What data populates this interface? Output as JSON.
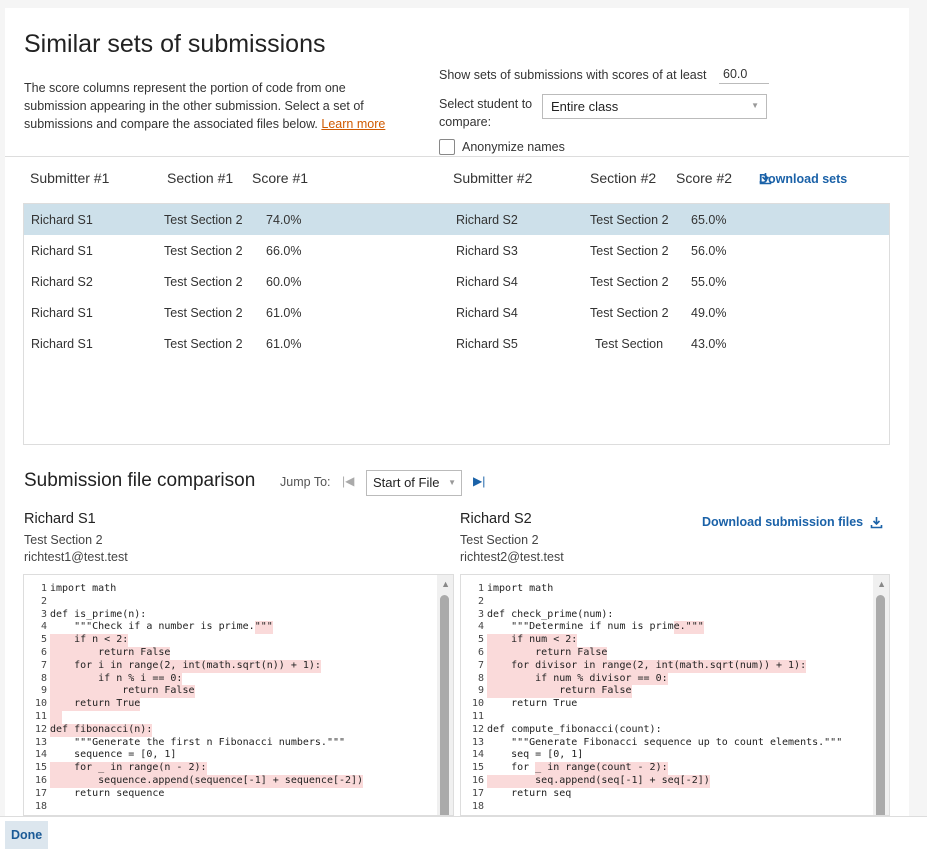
{
  "page": {
    "title": "Similar sets of submissions",
    "intro_text": "The score columns represent the portion of code from one submission appearing in the other submission. Select a set of submissions and compare the associated files below.",
    "learn_more": "Learn more"
  },
  "controls": {
    "threshold_label": "Show sets of submissions with scores of at least",
    "threshold_value": "60.0",
    "student_label": "Select student to compare:",
    "student_selected": "Entire class",
    "anonymize_label": "Anonymize names"
  },
  "table": {
    "headers": {
      "submitter1": "Submitter #1",
      "section1": "Section #1",
      "score1": "Score #1",
      "submitter2": "Submitter #2",
      "section2": "Section #2",
      "score2": "Score #2"
    },
    "download_sets": "Download sets",
    "rows": [
      {
        "sub1": "Richard S1",
        "sec1": "Test Section 2",
        "score1": "74.0%",
        "sub2": "Richard S2",
        "sec2": "Test Section 2",
        "score2": "65.0%"
      },
      {
        "sub1": "Richard S1",
        "sec1": "Test Section 2",
        "score1": "66.0%",
        "sub2": "Richard S3",
        "sec2": "Test Section 2",
        "score2": "56.0%"
      },
      {
        "sub1": "Richard S2",
        "sec1": "Test Section 2",
        "score1": "60.0%",
        "sub2": "Richard S4",
        "sec2": "Test Section 2",
        "score2": "55.0%"
      },
      {
        "sub1": "Richard S1",
        "sec1": "Test Section 2",
        "score1": "61.0%",
        "sub2": "Richard S4",
        "sec2": "Test Section 2",
        "score2": "49.0%"
      },
      {
        "sub1": "Richard S1",
        "sec1": "Test Section 2",
        "score1": "61.0%",
        "sub2": "Richard S5",
        "sec2": "Test Section",
        "score2": "43.0%"
      }
    ]
  },
  "comparison": {
    "title": "Submission file comparison",
    "jump_label": "Jump To:",
    "jump_selected": "Start of File",
    "download_files": "Download submission files",
    "left": {
      "name": "Richard S1",
      "section": "Test Section 2",
      "email": "richtest1@test.test"
    },
    "right": {
      "name": "Richard S2",
      "section": "Test Section 2",
      "email": "richtest2@test.test"
    }
  },
  "code_left": [
    {
      "n": "1",
      "segs": [
        [
          "import math",
          false
        ]
      ]
    },
    {
      "n": "2",
      "segs": [
        [
          "",
          false
        ]
      ]
    },
    {
      "n": "3",
      "segs": [
        [
          "def is_prime(n):",
          false
        ]
      ]
    },
    {
      "n": "4",
      "segs": [
        [
          "    \"\"\"Check if a number is prime.",
          false
        ],
        [
          "\"\"\"",
          true
        ]
      ]
    },
    {
      "n": "5",
      "segs": [
        [
          "    if n < 2:",
          true
        ]
      ]
    },
    {
      "n": "6",
      "segs": [
        [
          "        return False",
          true
        ]
      ]
    },
    {
      "n": "7",
      "segs": [
        [
          "    for i in range(2, int(math.sqrt(n)) + 1):",
          true
        ]
      ]
    },
    {
      "n": "8",
      "segs": [
        [
          "        if n % i == 0:",
          true
        ]
      ]
    },
    {
      "n": "9",
      "segs": [
        [
          "            return False",
          true
        ]
      ]
    },
    {
      "n": "10",
      "segs": [
        [
          "    return True",
          true
        ]
      ]
    },
    {
      "n": "11",
      "segs": [
        [
          "  ",
          true
        ]
      ]
    },
    {
      "n": "12",
      "segs": [
        [
          "def fibonacci(n):",
          true
        ]
      ]
    },
    {
      "n": "13",
      "segs": [
        [
          "    \"\"\"Generate the first n Fibonacci numbers.\"\"\"",
          false
        ]
      ]
    },
    {
      "n": "14",
      "segs": [
        [
          "    sequence = [0, 1]",
          false
        ]
      ]
    },
    {
      "n": "15",
      "segs": [
        [
          "    for _ in range(n - 2):",
          true
        ]
      ]
    },
    {
      "n": "16",
      "segs": [
        [
          "        sequence.append(sequence[-1] + sequence[-2])",
          true
        ]
      ]
    },
    {
      "n": "17",
      "segs": [
        [
          "    return sequence",
          false
        ]
      ]
    },
    {
      "n": "18",
      "segs": [
        [
          "",
          false
        ]
      ]
    }
  ],
  "code_right": [
    {
      "n": "1",
      "segs": [
        [
          "import math",
          false
        ]
      ]
    },
    {
      "n": "2",
      "segs": [
        [
          "",
          false
        ]
      ]
    },
    {
      "n": "3",
      "segs": [
        [
          "def check_prime(num):",
          false
        ]
      ]
    },
    {
      "n": "4",
      "segs": [
        [
          "    \"\"\"Determine if num is prim",
          false
        ],
        [
          "e.\"\"\"",
          true
        ]
      ]
    },
    {
      "n": "5",
      "segs": [
        [
          "    if num < 2:",
          true
        ]
      ]
    },
    {
      "n": "6",
      "segs": [
        [
          "        return False",
          true
        ]
      ]
    },
    {
      "n": "7",
      "segs": [
        [
          "    for divisor in range(2, int(math.sqrt(num)) + 1):",
          true
        ]
      ]
    },
    {
      "n": "8",
      "segs": [
        [
          "        if num % divisor == 0:",
          true
        ]
      ]
    },
    {
      "n": "9",
      "segs": [
        [
          "            return False",
          true
        ]
      ]
    },
    {
      "n": "10",
      "segs": [
        [
          "    return True",
          false
        ]
      ]
    },
    {
      "n": "11",
      "segs": [
        [
          "",
          false
        ]
      ]
    },
    {
      "n": "12",
      "segs": [
        [
          "def compute_fibonacci(count):",
          false
        ]
      ]
    },
    {
      "n": "13",
      "segs": [
        [
          "    \"\"\"Generate Fibonacci sequence up to count elements.\"\"\"",
          false
        ]
      ]
    },
    {
      "n": "14",
      "segs": [
        [
          "    seq = [0, 1]",
          false
        ]
      ]
    },
    {
      "n": "15",
      "segs": [
        [
          "    for ",
          false
        ],
        [
          "_ in range(count - 2):",
          true
        ]
      ]
    },
    {
      "n": "16",
      "segs": [
        [
          "        seq.append(seq[-1] + seq[-2])",
          true
        ]
      ]
    },
    {
      "n": "17",
      "segs": [
        [
          "    return seq",
          false
        ]
      ]
    },
    {
      "n": "18",
      "segs": [
        [
          "",
          false
        ]
      ]
    }
  ],
  "footer": {
    "done_label": "Done"
  },
  "colors": {
    "accent": "#1b62a8",
    "selected_row": "#cde0ea",
    "highlight": "#fadada",
    "link": "#d05a00"
  }
}
